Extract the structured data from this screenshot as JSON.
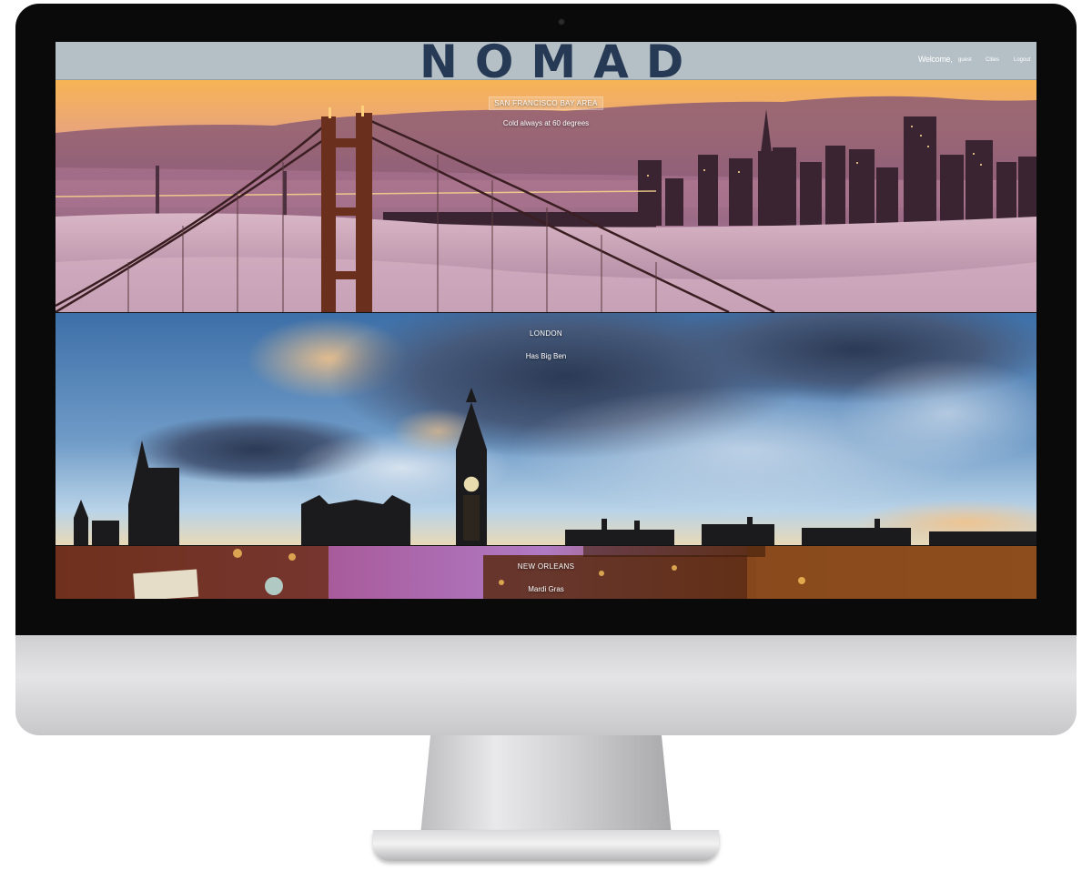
{
  "app": {
    "logo": "NOMAD",
    "welcome_label": "Welcome,",
    "username": "guest",
    "nav": {
      "cities": "Cities",
      "logout": "Logout"
    }
  },
  "cities": [
    {
      "name": "SAN FRANCISCO BAY AREA",
      "tagline": "Cold always at 60 degrees"
    },
    {
      "name": "LONDON",
      "tagline": "Has Big Ben"
    },
    {
      "name": "NEW ORLEANS",
      "tagline": "Mardi Gras"
    }
  ],
  "colors": {
    "header_bg": "#b4bfc6",
    "logo": "#273a55",
    "accent_sunset": "#f2b46a",
    "fog": "#c69ab0"
  }
}
